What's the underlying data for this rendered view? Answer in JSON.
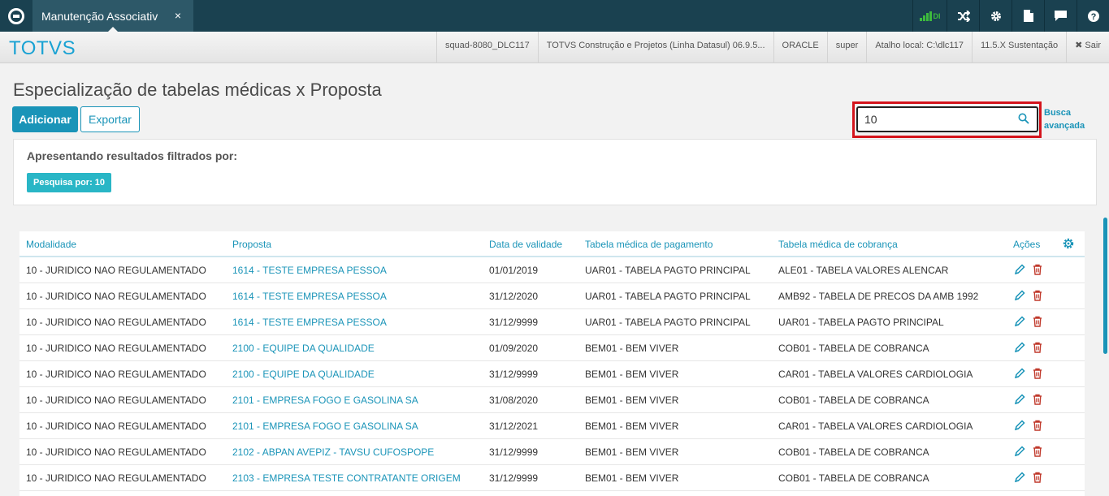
{
  "topbar": {
    "tab_label": "Manutenção Associativ",
    "tab_close": "×",
    "signal_label": "DI",
    "icons": [
      "logo-icon",
      "signal-icon",
      "shuffle-icon",
      "gear-icon",
      "document-icon",
      "chat-icon",
      "help-icon"
    ]
  },
  "header": {
    "brand": "TOTVS",
    "info": {
      "server": "squad-8080_DLC117",
      "product": "TOTVS Construção e Projetos (Linha Datasul) 06.9.5...",
      "database": "ORACLE",
      "user": "super",
      "shortcut": "Atalho local: C:\\dlc117",
      "version": "11.5.X Sustentação",
      "exit": "✖ Sair"
    }
  },
  "page": {
    "title": "Especialização de tabelas médicas x Proposta",
    "add_label": "Adicionar",
    "export_label": "Exportar",
    "search_value": "10",
    "advanced_search": "Busca avançada",
    "filter_title": "Apresentando resultados filtrados por:",
    "filter_chip": "Pesquisa por: 10"
  },
  "table": {
    "columns": {
      "modalidade": "Modalidade",
      "proposta": "Proposta",
      "validade": "Data de validade",
      "pagamento": "Tabela médica de pagamento",
      "cobranca": "Tabela médica de cobrança",
      "acoes": "Ações"
    },
    "rows": [
      {
        "modalidade": "10 - JURIDICO NAO REGULAMENTADO",
        "proposta": "1614 - TESTE EMPRESA PESSOA",
        "validade": "01/01/2019",
        "pagamento": "UAR01 - TABELA PAGTO PRINCIPAL",
        "cobranca": "ALE01 - TABELA VALORES ALENCAR"
      },
      {
        "modalidade": "10 - JURIDICO NAO REGULAMENTADO",
        "proposta": "1614 - TESTE EMPRESA PESSOA",
        "validade": "31/12/2020",
        "pagamento": "UAR01 - TABELA PAGTO PRINCIPAL",
        "cobranca": "AMB92 - TABELA DE PRECOS DA AMB 1992"
      },
      {
        "modalidade": "10 - JURIDICO NAO REGULAMENTADO",
        "proposta": "1614 - TESTE EMPRESA PESSOA",
        "validade": "31/12/9999",
        "pagamento": "UAR01 - TABELA PAGTO PRINCIPAL",
        "cobranca": "UAR01 - TABELA PAGTO PRINCIPAL"
      },
      {
        "modalidade": "10 - JURIDICO NAO REGULAMENTADO",
        "proposta": "2100 - EQUIPE DA QUALIDADE",
        "validade": "01/09/2020",
        "pagamento": "BEM01 - BEM VIVER",
        "cobranca": "COB01 - TABELA DE COBRANCA"
      },
      {
        "modalidade": "10 - JURIDICO NAO REGULAMENTADO",
        "proposta": "2100 - EQUIPE DA QUALIDADE",
        "validade": "31/12/9999",
        "pagamento": "BEM01 - BEM VIVER",
        "cobranca": "CAR01 - TABELA VALORES CARDIOLOGIA"
      },
      {
        "modalidade": "10 - JURIDICO NAO REGULAMENTADO",
        "proposta": "2101 - EMPRESA FOGO E GASOLINA SA",
        "validade": "31/08/2020",
        "pagamento": "BEM01 - BEM VIVER",
        "cobranca": "COB01 - TABELA DE COBRANCA"
      },
      {
        "modalidade": "10 - JURIDICO NAO REGULAMENTADO",
        "proposta": "2101 - EMPRESA FOGO E GASOLINA SA",
        "validade": "31/12/2021",
        "pagamento": "BEM01 - BEM VIVER",
        "cobranca": "CAR01 - TABELA VALORES CARDIOLOGIA"
      },
      {
        "modalidade": "10 - JURIDICO NAO REGULAMENTADO",
        "proposta": "2102 - ABPAN AVEPIZ - TAVSU CUFOSPOPE",
        "validade": "31/12/9999",
        "pagamento": "BEM01 - BEM VIVER",
        "cobranca": "COB01 - TABELA DE COBRANCA"
      },
      {
        "modalidade": "10 - JURIDICO NAO REGULAMENTADO",
        "proposta": "2103 - EMPRESA TESTE CONTRATANTE ORIGEM",
        "validade": "31/12/9999",
        "pagamento": "BEM01 - BEM VIVER",
        "cobranca": "COB01 - TABELA DE COBRANCA"
      }
    ]
  },
  "colors": {
    "accent": "#1a94b8",
    "topbar": "#1a4150",
    "highlight": "#d4141c",
    "delete": "#c0392b"
  }
}
